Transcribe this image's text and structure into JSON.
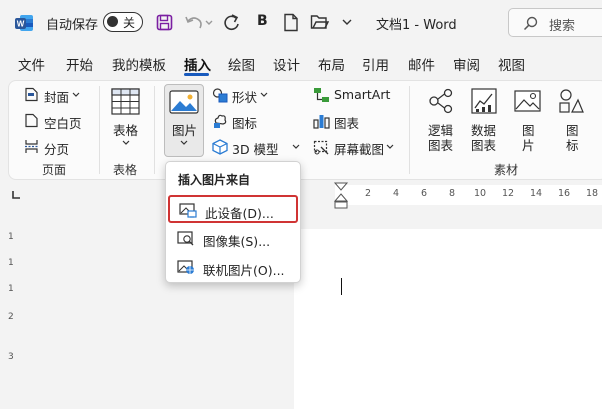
{
  "titlebar": {
    "autosave_label": "自动保存",
    "autosave_state": "关",
    "document_title": "文档1 - Word",
    "search_placeholder": "搜索",
    "bold_label": "B"
  },
  "tabs": [
    "文件",
    "开始",
    "我的模板",
    "插入",
    "绘图",
    "设计",
    "布局",
    "引用",
    "邮件",
    "审阅",
    "视图"
  ],
  "active_tab": "插入",
  "ribbon": {
    "pages": {
      "cover": "封面",
      "blank": "空白页",
      "break": "分页",
      "group": "页面"
    },
    "table": {
      "button": "表格",
      "group": "表格"
    },
    "illustrations": {
      "picture": "图片",
      "shapes": "形状",
      "icons": "图标",
      "model3d": "3D 模型",
      "smartart": "SmartArt",
      "chart": "图表",
      "screenshot": "屏幕截图"
    },
    "material": {
      "logic_chart": [
        "逻辑",
        "图表"
      ],
      "data_chart": [
        "数据",
        "图表"
      ],
      "picture": [
        "图",
        "片"
      ],
      "icon": [
        "图",
        "标"
      ],
      "group": "素材"
    }
  },
  "dropdown": {
    "title": "插入图片来自",
    "items": [
      "此设备(D)...",
      "图像集(S)...",
      "联机图片(O)..."
    ],
    "selected_index": 0
  },
  "ruler": {
    "numbers": [
      "2",
      "4",
      "6",
      "8",
      "10",
      "12",
      "14",
      "16",
      "18"
    ],
    "vertical": [
      "1",
      "1",
      "1",
      "2",
      "3"
    ]
  },
  "colors": {
    "accent": "#185abd",
    "highlight": "#d03434",
    "word_blue": "#2b579a"
  }
}
